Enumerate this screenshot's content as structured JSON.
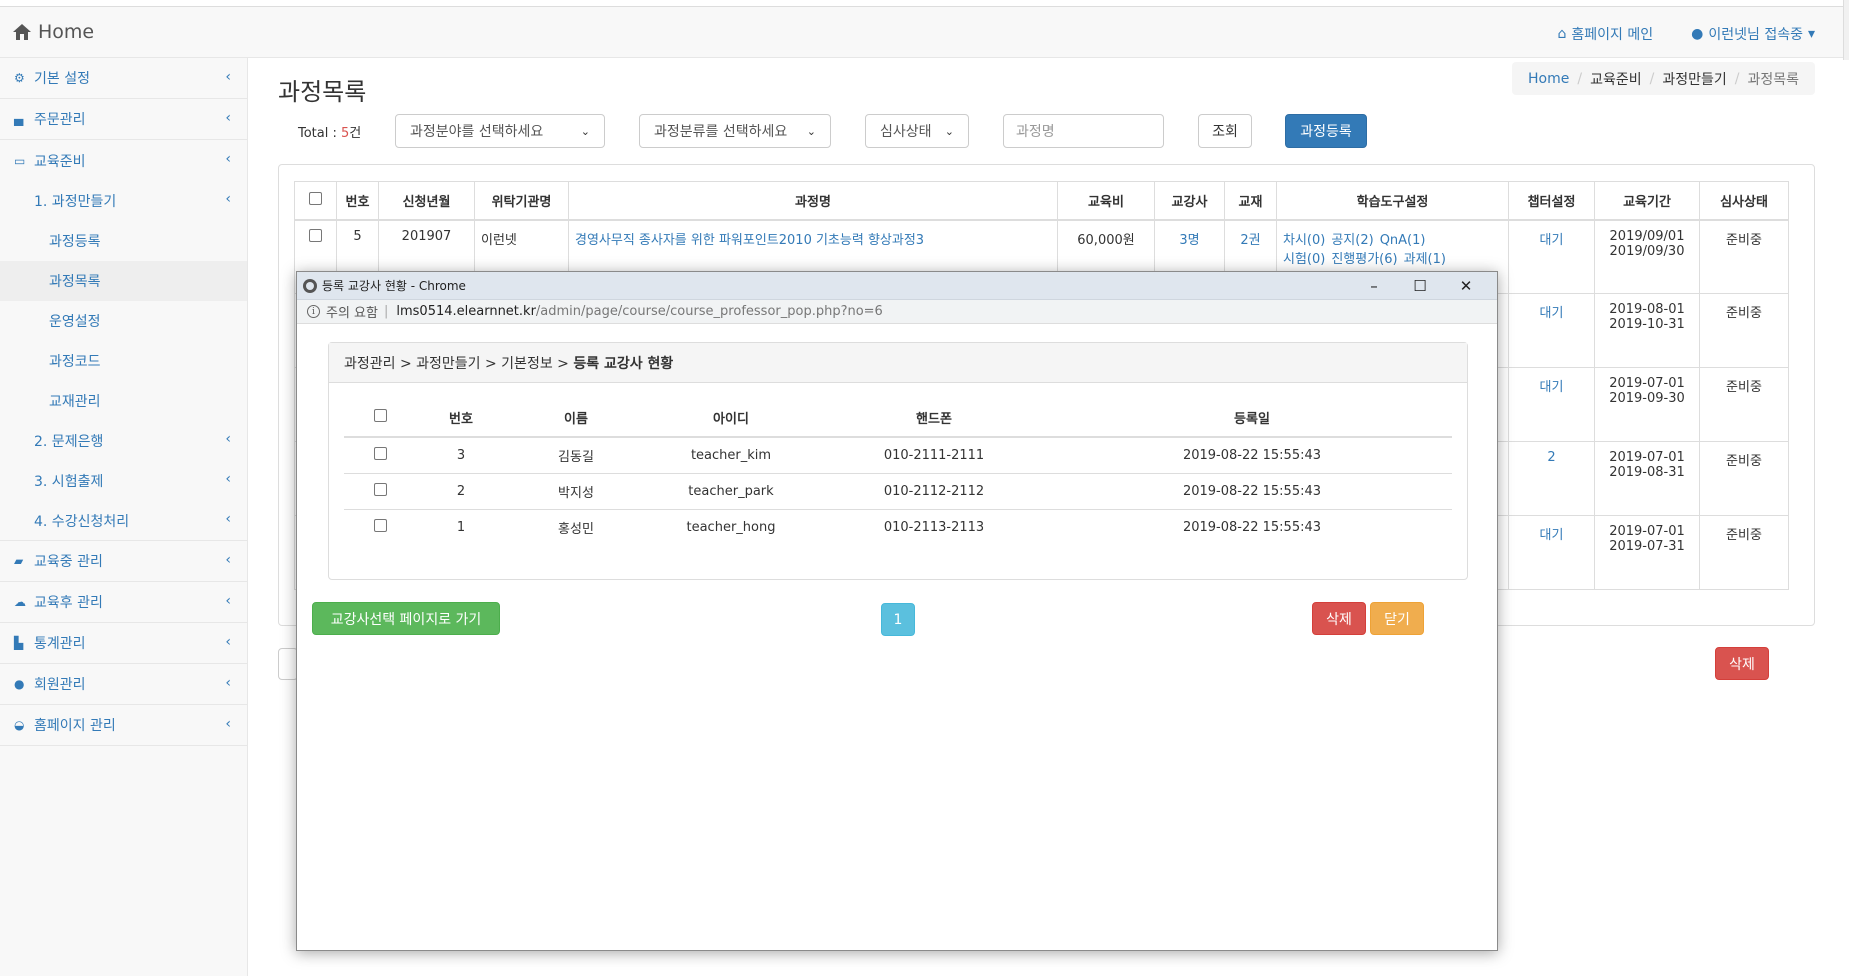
{
  "navbar": {
    "brand": "Home",
    "homepage_main": "홈페이지 메인",
    "user_status": "이런넷님 접속중"
  },
  "sidebar": {
    "items": [
      {
        "label": "기본 설정"
      },
      {
        "label": "주문관리"
      },
      {
        "label": "교육준비"
      }
    ],
    "sub": {
      "course_make": "1. 과정만들기",
      "course_register": "과정등록",
      "course_list": "과정목록",
      "operation": "운영설정",
      "course_code": "과정코드",
      "textbook": "교재관리",
      "question_bank": "2. 문제은행",
      "exam": "3. 시험출제",
      "enroll": "4. 수강신청처리"
    },
    "bottom_items": [
      {
        "label": "교육중 관리"
      },
      {
        "label": "교육후 관리"
      },
      {
        "label": "통계관리"
      },
      {
        "label": "회원관리"
      },
      {
        "label": "홈페이지 관리"
      }
    ]
  },
  "page": {
    "title": "과정목록",
    "breadcrumb": [
      "Home",
      "교육준비",
      "과정만들기",
      "과정목록"
    ]
  },
  "filters": {
    "total_label": "Total : ",
    "total_count": "5",
    "total_unit": "건",
    "field_select": "과정분야를 선택하세요",
    "category_select": "과정분류를 선택하세요",
    "review_select": "심사상태",
    "name_placeholder": "과정명",
    "search_button": "조회",
    "register_button": "과정등록"
  },
  "table": {
    "headers": [
      "번호",
      "신청년월",
      "위탁기관명",
      "과정명",
      "교육비",
      "교강사",
      "교재",
      "학습도구설정",
      "챕터설정",
      "교육기간",
      "심사상태"
    ],
    "first_row": {
      "no": "5",
      "month": "201907",
      "org": "이런넷",
      "course": "경영사무직 종사자를 위한 파워포인트2010 기초능력 향상과정3",
      "fee": "60,000원",
      "instructors": "3명",
      "textbooks": "2권",
      "tools_line1": [
        "차시(0)",
        "공지(2)",
        "QnA(1)"
      ],
      "tools_line2": [
        "시험(0)",
        "진행평가(6)",
        "과제(1)"
      ]
    },
    "right_rows": [
      {
        "chapter": "대기",
        "start": "2019/09/01",
        "end": "2019/09/30",
        "status": "준비중"
      },
      {
        "chapter": "대기",
        "start": "2019-08-01",
        "end": "2019-10-31",
        "status": "준비중"
      },
      {
        "chapter": "대기",
        "start": "2019-07-01",
        "end": "2019-09-30",
        "status": "준비중"
      },
      {
        "chapter": "2",
        "start": "2019-07-01",
        "end": "2019-08-31",
        "status": "준비중"
      },
      {
        "chapter": "대기",
        "start": "2019-07-01",
        "end": "2019-07-31",
        "status": "준비중"
      }
    ],
    "delete_button": "삭제"
  },
  "popup": {
    "window_title": "등록 교강사 현황 - Chrome",
    "address_warning": "주의 요함",
    "address_host": "lms0514.elearnnet.kr",
    "address_path": "/admin/page/course/course_professor_pop.php?no=6",
    "breadcrumb": "과정관리 > 과정만들기 > 기본정보 > ",
    "breadcrumb_current": "등록 교강사 현황",
    "headers": [
      "번호",
      "이름",
      "아이디",
      "핸드폰",
      "등록일"
    ],
    "rows": [
      {
        "no": "3",
        "name": "김동길",
        "id": "teacher_kim",
        "phone": "010-2111-2111",
        "date": "2019-08-22 15:55:43"
      },
      {
        "no": "2",
        "name": "박지성",
        "id": "teacher_park",
        "phone": "010-2112-2112",
        "date": "2019-08-22 15:55:43"
      },
      {
        "no": "1",
        "name": "홍성민",
        "id": "teacher_hong",
        "phone": "010-2113-2113",
        "date": "2019-08-22 15:55:43"
      }
    ],
    "go_select_button": "교강사선택 페이지로 가기",
    "page_number": "1",
    "delete_button": "삭제",
    "close_button": "닫기"
  }
}
